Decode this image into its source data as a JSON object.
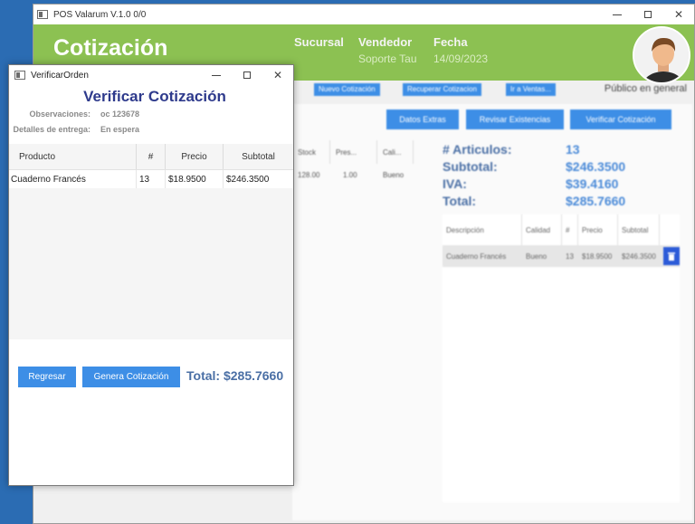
{
  "main_window": {
    "title": "POS Valarum  V.1.0  0/0",
    "header": {
      "title": "Cotización",
      "sucursal_label": "Sucursal",
      "vendedor_label": "Vendedor",
      "vendedor_value": "Soporte Tau",
      "fecha_label": "Fecha",
      "fecha_value": "14/09/2023"
    },
    "toolbar": {
      "nueva": "Nuevo Cotización",
      "recuperar": "Recuperar Cotizacion",
      "ir_ventas": "Ir a Ventas...",
      "cliente": "Público en general"
    },
    "actions": {
      "datos_extras": "Datos Extras",
      "revisar_existencias": "Revisar Existencias",
      "verificar": "Verificar Cotización"
    },
    "stock_table": {
      "headers": [
        "Stock",
        "Pres...",
        "Cali..."
      ],
      "row": [
        "128.00",
        "1.00",
        "Bueno"
      ]
    },
    "totals": {
      "articulos_label": "# Articulos:",
      "articulos_value": "13",
      "subtotal_label": "Subtotal:",
      "subtotal_value": "$246.3500",
      "iva_label": "IVA:",
      "iva_value": "$39.4160",
      "total_label": "Total:",
      "total_value": "$285.7660"
    },
    "detail_table": {
      "headers": [
        "Descripción",
        "Calidad",
        "#",
        "Precio",
        "Subtotal"
      ],
      "row": [
        "Cuaderno Francés",
        "Bueno",
        "13",
        "$18.9500",
        "$246.3500"
      ]
    }
  },
  "dialog": {
    "title": "VerificarOrden",
    "heading": "Verificar Cotización",
    "observaciones_label": "Observaciones:",
    "observaciones_value": "oc 123678",
    "detalles_label": "Detalles de entrega:",
    "detalles_value": "En espera",
    "table": {
      "headers": [
        "Producto",
        "#",
        "Precio",
        "Subtotal"
      ],
      "rows": [
        [
          "Cuaderno Francés",
          "13",
          "$18.9500",
          "$246.3500"
        ]
      ]
    },
    "regresar": "Regresar",
    "genera": "Genera Cotización",
    "total_text": "Total: $285.7660"
  },
  "colors": {
    "header_green": "#8cc152",
    "button_blue": "#3d8ee6",
    "heading_navy": "#2e3a8c",
    "desktop_blue": "#2b6cb3"
  }
}
